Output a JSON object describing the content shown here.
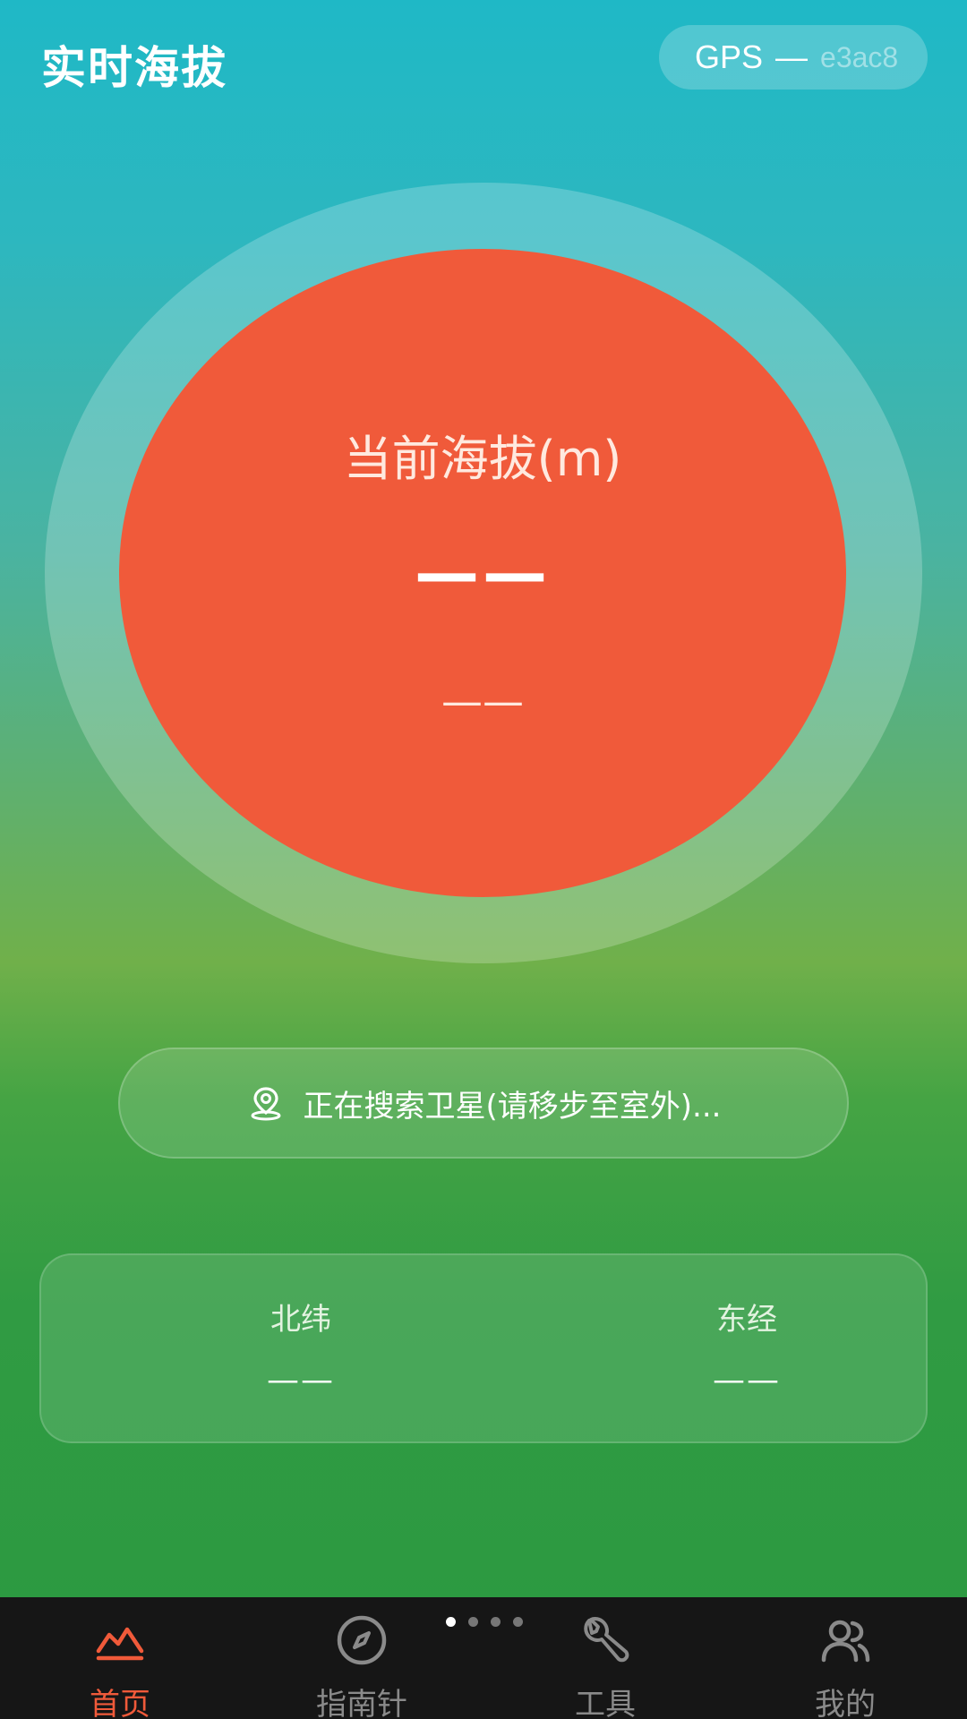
{
  "header": {
    "title": "实时海拔",
    "gps_label": "GPS",
    "gps_dash": "—",
    "gps_value": "e3ac8"
  },
  "altitude": {
    "label": "当前海拔(m)",
    "value": "——",
    "sub_value": "——"
  },
  "status": {
    "text": "正在搜索卫星(请移步至室外)...",
    "icon": "location-pin-icon"
  },
  "coordinates": {
    "latitude_label": "北纬",
    "latitude_value": "——",
    "longitude_label": "东经",
    "longitude_value": "——"
  },
  "tabs": [
    {
      "label": "首页",
      "icon": "mountain-icon",
      "active": true
    },
    {
      "label": "指南针",
      "icon": "compass-icon",
      "active": false
    },
    {
      "label": "工具",
      "icon": "wrench-icon",
      "active": false
    },
    {
      "label": "我的",
      "icon": "people-icon",
      "active": false
    }
  ],
  "colors": {
    "accent": "#f05a3a",
    "tab_inactive": "#8a8a8a",
    "tabbar_bg": "#161616"
  }
}
